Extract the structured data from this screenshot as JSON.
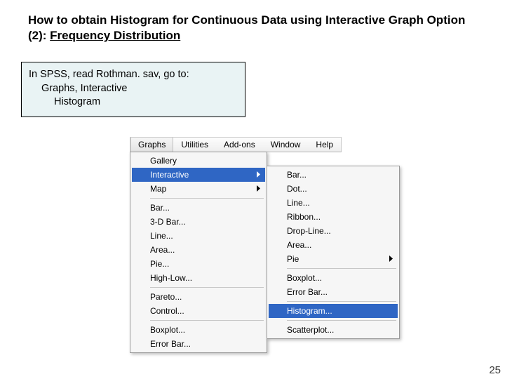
{
  "title_part1": "How to obtain Histogram for Continuous Data using Interactive Graph Option (2): ",
  "title_part2_ul": "Frequency Distribution",
  "instruction": {
    "line1": "In SPSS, read Rothman. sav, go to:",
    "line2": "Graphs, Interactive",
    "line3": "Histogram"
  },
  "menubar": [
    "Graphs",
    "Utilities",
    "Add-ons",
    "Window",
    "Help"
  ],
  "menubar_open_index": 0,
  "main_menu": [
    {
      "label": "Gallery",
      "arrow": false,
      "sel": false
    },
    {
      "label": "Interactive",
      "arrow": true,
      "sel": true
    },
    {
      "label": "Map",
      "arrow": true,
      "sel": false
    },
    {
      "sep": true
    },
    {
      "label": "Bar...",
      "arrow": false,
      "sel": false
    },
    {
      "label": "3-D Bar...",
      "arrow": false,
      "sel": false
    },
    {
      "label": "Line...",
      "arrow": false,
      "sel": false
    },
    {
      "label": "Area...",
      "arrow": false,
      "sel": false
    },
    {
      "label": "Pie...",
      "arrow": false,
      "sel": false
    },
    {
      "label": "High-Low...",
      "arrow": false,
      "sel": false
    },
    {
      "sep": true
    },
    {
      "label": "Pareto...",
      "arrow": false,
      "sel": false
    },
    {
      "label": "Control...",
      "arrow": false,
      "sel": false
    },
    {
      "sep": true
    },
    {
      "label": "Boxplot...",
      "arrow": false,
      "sel": false
    },
    {
      "label": "Error Bar...",
      "arrow": false,
      "sel": false
    }
  ],
  "sub_menu": [
    {
      "label": "Bar...",
      "arrow": false,
      "sel": false
    },
    {
      "label": "Dot...",
      "arrow": false,
      "sel": false
    },
    {
      "label": "Line...",
      "arrow": false,
      "sel": false
    },
    {
      "label": "Ribbon...",
      "arrow": false,
      "sel": false
    },
    {
      "label": "Drop-Line...",
      "arrow": false,
      "sel": false
    },
    {
      "label": "Area...",
      "arrow": false,
      "sel": false
    },
    {
      "label": "Pie",
      "arrow": true,
      "sel": false
    },
    {
      "sep": true
    },
    {
      "label": "Boxplot...",
      "arrow": false,
      "sel": false
    },
    {
      "label": "Error Bar...",
      "arrow": false,
      "sel": false
    },
    {
      "sep": true
    },
    {
      "label": "Histogram...",
      "arrow": false,
      "sel": true
    },
    {
      "sep": true
    },
    {
      "label": "Scatterplot...",
      "arrow": false,
      "sel": false
    }
  ],
  "page_number": "25"
}
